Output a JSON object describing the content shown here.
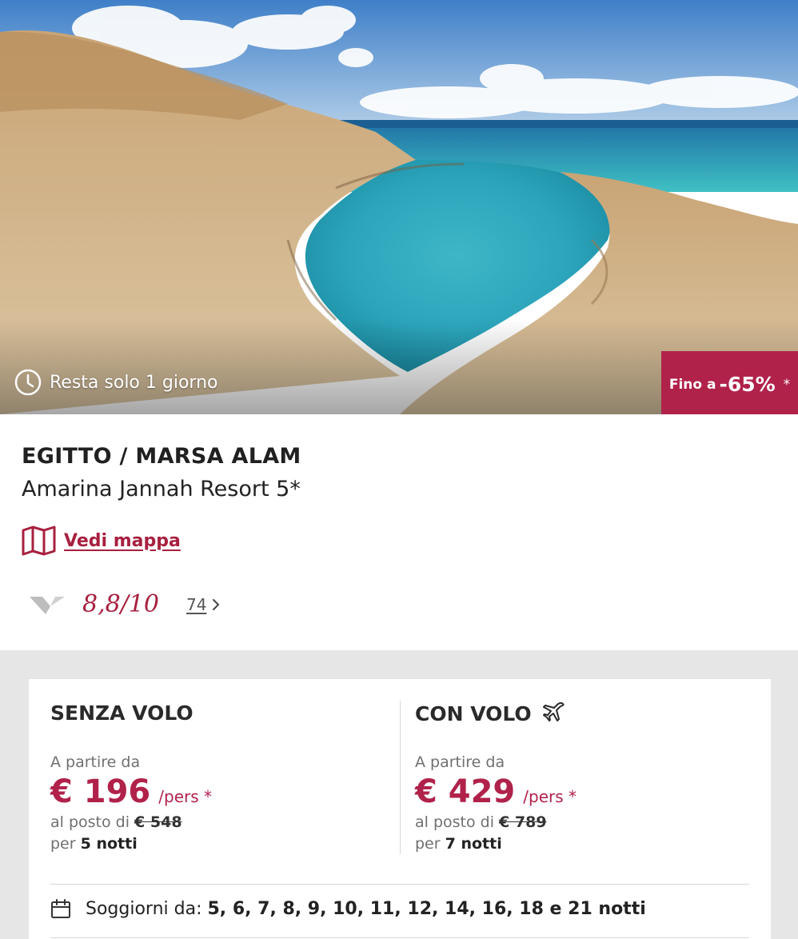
{
  "hero": {
    "timer_text": "Resta solo 1 giorno",
    "discount_prefix": "Fino a",
    "discount_value": "-65%",
    "discount_asterisk": "*"
  },
  "hotel": {
    "location": "EGITTO / MARSA ALAM",
    "name": "Amarina Jannah Resort 5*",
    "map_link": "Vedi mappa",
    "rating": "8,8/10",
    "reviews_count": "74"
  },
  "offers": {
    "without_flight": {
      "title": "SENZA VOLO",
      "from_label": "A partire da",
      "price": "€ 196",
      "per_person": "/pers *",
      "instead_label": "al posto di",
      "old_price": "€ 548",
      "nights_prefix": "per",
      "nights": "5 notti"
    },
    "with_flight": {
      "title": "CON VOLO",
      "from_label": "A partire da",
      "price": "€ 429",
      "per_person": "/pers *",
      "instead_label": "al posto di",
      "old_price": "€ 789",
      "nights_prefix": "per",
      "nights": "7 notti"
    },
    "stays_label": "Soggiorni da:",
    "stays_values": "5, 6, 7, 8, 9, 10, 11, 12, 14, 16, 18 e 21 notti"
  },
  "icons": {
    "timer": "clock-icon",
    "map": "map-icon",
    "rating_logo": "rating-logo-icon",
    "reviews_more": "chevron-right-icon",
    "flight": "airplane-icon",
    "calendar": "calendar-icon"
  },
  "colors": {
    "brand": "#b0224a",
    "link": "#a8203f",
    "price_panel_bg": "#e6e6e6"
  }
}
